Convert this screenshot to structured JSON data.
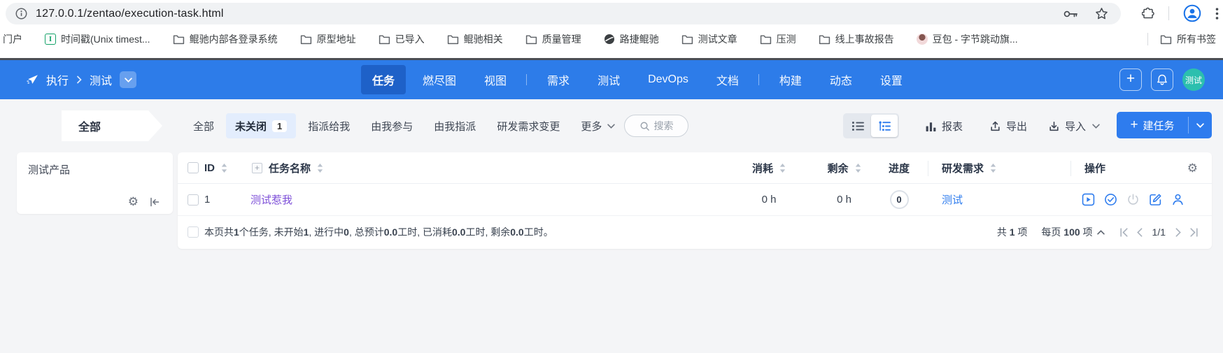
{
  "browser": {
    "url": "127.0.0.1/zentao/execution-task.html",
    "bookmarks": [
      {
        "label": "门户",
        "icon": "none"
      },
      {
        "label": "时间戳(Unix timest...",
        "icon": "timestamp"
      },
      {
        "label": "鲲驰内部各登录系统",
        "icon": "folder"
      },
      {
        "label": "原型地址",
        "icon": "folder"
      },
      {
        "label": "已导入",
        "icon": "folder"
      },
      {
        "label": "鲲驰相关",
        "icon": "folder"
      },
      {
        "label": "质量管理",
        "icon": "folder"
      },
      {
        "label": "路捷鲲驰",
        "icon": "globe"
      },
      {
        "label": "测试文章",
        "icon": "folder"
      },
      {
        "label": "压测",
        "icon": "folder"
      },
      {
        "label": "线上事故报告",
        "icon": "folder"
      },
      {
        "label": "豆包 - 字节跳动旗...",
        "icon": "avatar"
      },
      {
        "label": "所有书签",
        "icon": "folder",
        "divider": true
      }
    ]
  },
  "navbar": {
    "app_label": "执行",
    "project_label": "测试",
    "avatar_text": "测试",
    "menu": [
      {
        "label": "任务",
        "active": true
      },
      {
        "label": "燃尽图"
      },
      {
        "label": "视图"
      },
      {
        "label": "需求",
        "divider": true
      },
      {
        "label": "测试"
      },
      {
        "label": "DevOps"
      },
      {
        "label": "文档"
      },
      {
        "label": "构建",
        "divider": true
      },
      {
        "label": "动态"
      },
      {
        "label": "设置"
      }
    ]
  },
  "toolbar": {
    "sidebar_header": "全部",
    "tabs": [
      {
        "label": "全部"
      },
      {
        "label": "未关闭",
        "active": true,
        "badge": "1"
      },
      {
        "label": "指派给我"
      },
      {
        "label": "由我参与"
      },
      {
        "label": "由我指派"
      },
      {
        "label": "研发需求变更"
      },
      {
        "label": "更多",
        "caret": true
      }
    ],
    "search_placeholder": "搜索",
    "report_label": "报表",
    "export_label": "导出",
    "import_label": "导入",
    "create_task_label": "建任务"
  },
  "sidebar": {
    "items": [
      {
        "label": "测试产品"
      }
    ]
  },
  "task_table": {
    "columns": {
      "id": "ID",
      "name": "任务名称",
      "consumed": "消耗",
      "remaining": "剩余",
      "progress": "进度",
      "requirement": "研发需求",
      "actions": "操作"
    },
    "row": {
      "id": "1",
      "name": "测试惹我",
      "consumed": "0 h",
      "remaining": "0 h",
      "progress": "0",
      "requirement": "测试"
    },
    "summary_parts": [
      {
        "t": "本页共 "
      },
      {
        "t": "1",
        "b": true
      },
      {
        "t": " 个任务, 未开始 "
      },
      {
        "t": "1",
        "b": true
      },
      {
        "t": ", 进行中 "
      },
      {
        "t": "0",
        "b": true
      },
      {
        "t": ", 总预计 "
      },
      {
        "t": "0.0",
        "b": true
      },
      {
        "t": " 工时, 已消耗 "
      },
      {
        "t": "0.0",
        "b": true
      },
      {
        "t": " 工时, 剩余 "
      },
      {
        "t": "0.0",
        "b": true
      },
      {
        "t": " 工时。"
      }
    ],
    "pagination": {
      "total_parts": [
        {
          "t": "共 "
        },
        {
          "t": "1",
          "b": true
        },
        {
          "t": " 项"
        }
      ],
      "per_page_parts": [
        {
          "t": "每页 "
        },
        {
          "t": "100",
          "b": true
        },
        {
          "t": " 项"
        }
      ],
      "page": "1/1"
    }
  },
  "colors": {
    "accent_blue": "#2e7cee",
    "navbar_blue": "#2d7ce9",
    "active_nav_blue": "#1e61c8",
    "link_purple": "#7d4fd8",
    "avatar_teal": "#2cbfae"
  }
}
